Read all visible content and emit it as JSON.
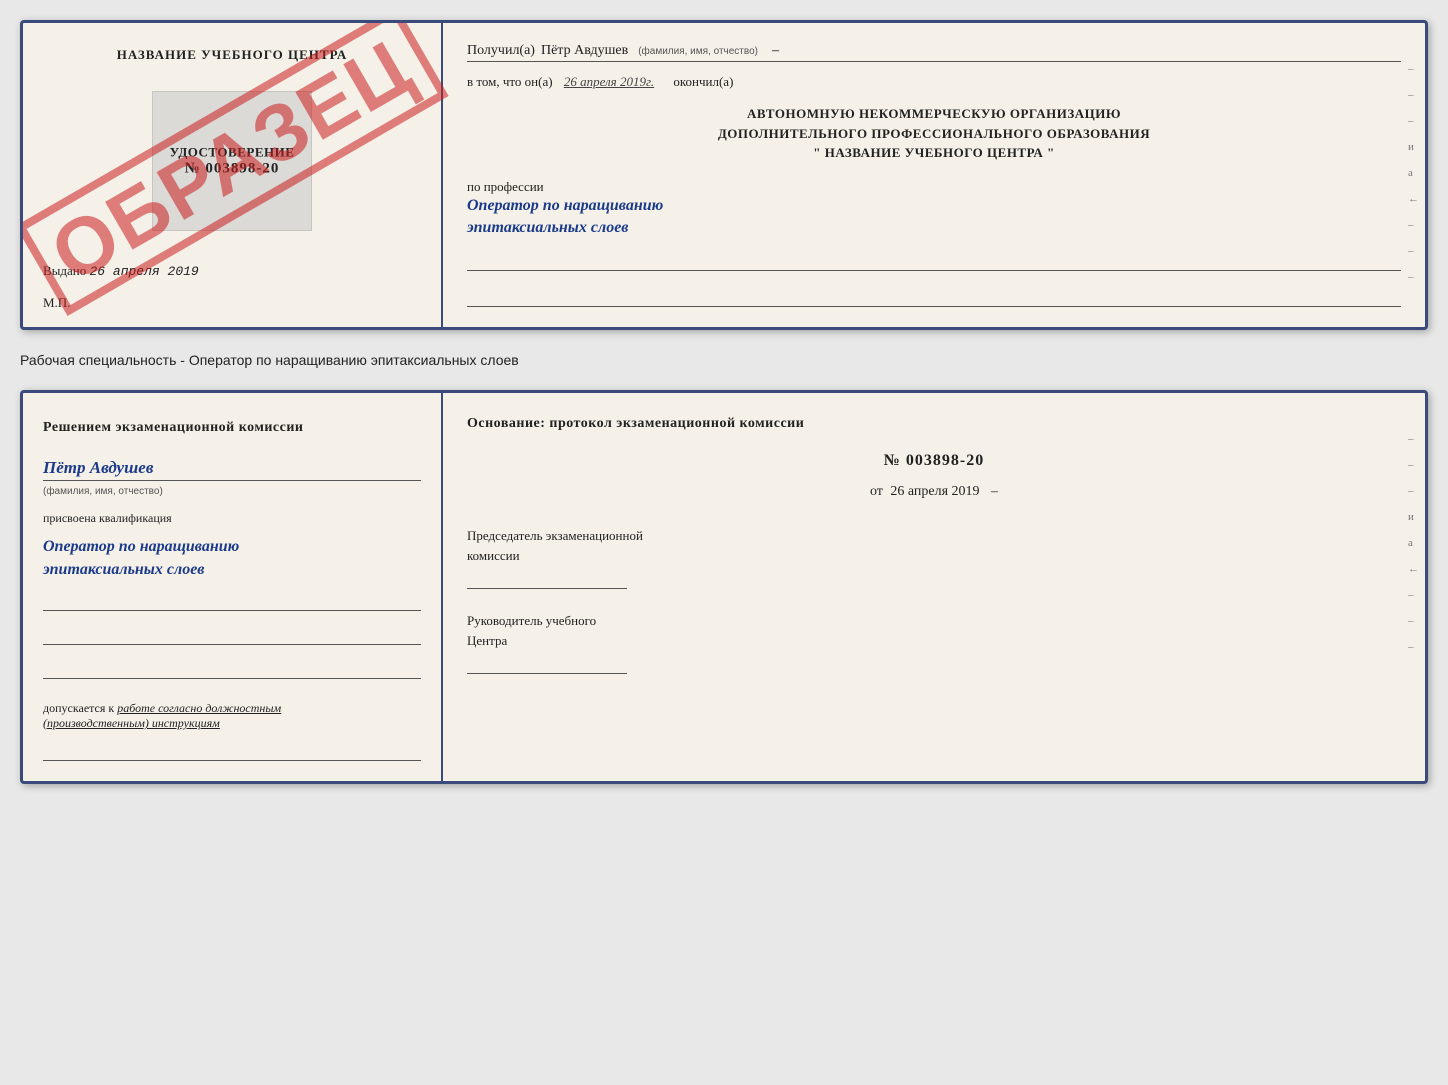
{
  "page": {
    "background_color": "#e8e8e8"
  },
  "card1": {
    "left": {
      "title": "НАЗВАНИЕ УЧЕБНОГО ЦЕНТРА",
      "udostoverenie_label": "УДОСТОВЕРЕНИЕ",
      "udostoverenie_number": "№ 003898-20",
      "obrazec": "ОБРАЗЕЦ",
      "vydano_prefix": "Выдано",
      "vydano_date": "26 апреля 2019",
      "mp_label": "М.П."
    },
    "right": {
      "poluchil_prefix": "Получил(а)",
      "recipient_name": "Пётр Авдушев",
      "fio_label": "(фамилия, имя, отчество)",
      "vtom_prefix": "в том, что он(а)",
      "vtom_date": "26 апреля 2019г.",
      "okochnil_suffix": "окончил(а)",
      "org_line1": "АВТОНОМНУЮ НЕКОММЕРЧЕСКУЮ ОРГАНИЗАЦИЮ",
      "org_line2": "ДОПОЛНИТЕЛЬНОГО ПРОФЕССИОНАЛЬНОГО ОБРАЗОВАНИЯ",
      "org_line3": "\"  НАЗВАНИЕ УЧЕБНОГО ЦЕНТРА  \"",
      "po_professii": "по профессии",
      "profession_handwritten": "Оператор по наращиванию\nэпитаксиальных слоев",
      "edge_marks": [
        "-",
        "-",
        "-",
        "и",
        "а",
        "←",
        "-",
        "-",
        "-"
      ]
    }
  },
  "separator": {
    "text": "Рабочая специальность - Оператор по наращиванию эпитаксиальных слоев"
  },
  "card2": {
    "left": {
      "resheniem_text": "Решением  экзаменационной  комиссии",
      "name_handwritten": "Пётр Авдушев",
      "fio_label": "(фамилия, имя, отчество)",
      "prisvoena_text": "присвоена квалификация",
      "kvalf_handwritten": "Оператор по наращиванию\nэпитаксиальных слоев",
      "dopuskaetsya_prefix": "допускается к",
      "dopuskaetsya_italic": "работе согласно должностным\n(производственным) инструкциям"
    },
    "right": {
      "osnovanie_text": "Основание: протокол экзаменационной  комиссии",
      "protocol_number": "№  003898-20",
      "ot_prefix": "от",
      "ot_date": "26 апреля 2019",
      "predsedatel_label": "Председатель экзаменационной\nкомиссии",
      "rukovoditel_label": "Руководитель учебного\nЦентра",
      "edge_marks": [
        "-",
        "-",
        "-",
        "и",
        "а",
        "←",
        "-",
        "-",
        "-"
      ]
    }
  }
}
